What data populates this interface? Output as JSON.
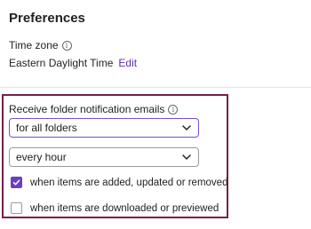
{
  "preferences": {
    "title": "Preferences",
    "time_zone": {
      "label": "Time zone",
      "info_icon": "info-circle-icon",
      "value": "Eastern Daylight Time",
      "edit_label": "Edit"
    },
    "notifications": {
      "label": "Receive folder notification emails",
      "info_icon": "info-circle-icon",
      "folder_scope_value": "for all folders",
      "frequency_value": "every hour",
      "options": [
        {
          "label": "when items are added, updated or removed",
          "checked": true
        },
        {
          "label": "when items are downloaded or previewed",
          "checked": false
        }
      ]
    }
  },
  "colors": {
    "accent": "#6a3fc1",
    "link": "#5b2ea6",
    "highlight_border": "#7a1f4a"
  }
}
